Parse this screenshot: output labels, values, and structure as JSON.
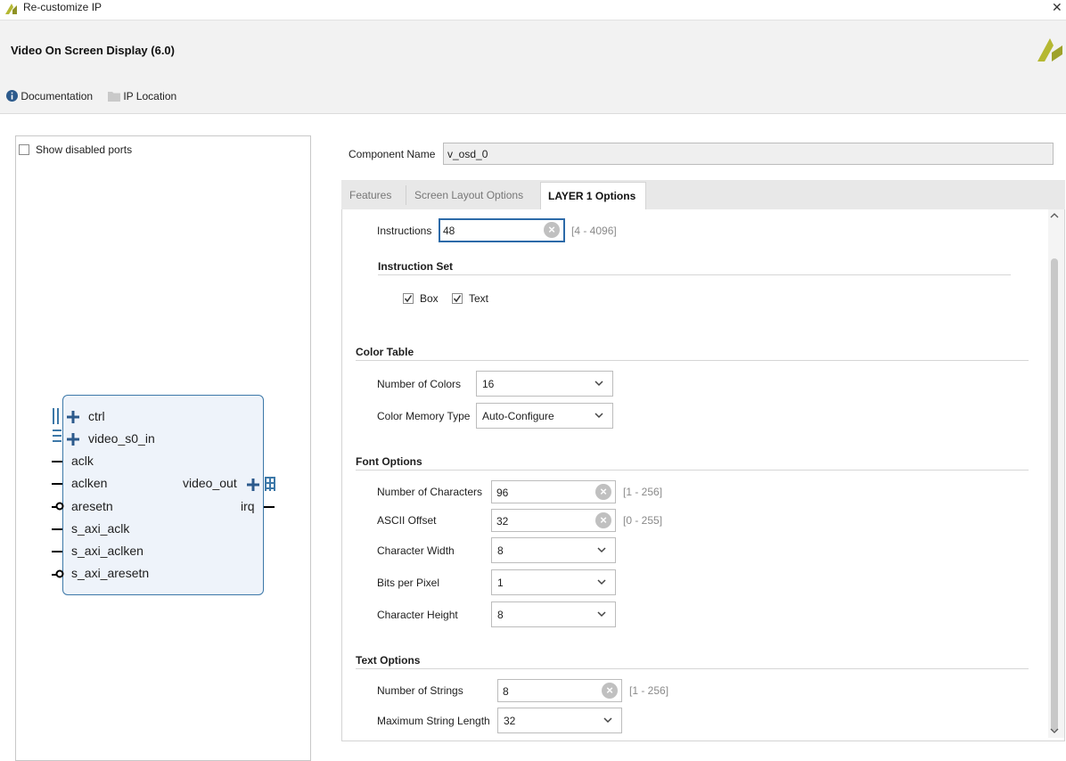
{
  "window": {
    "title": "Re-customize IP"
  },
  "header": {
    "title": "Video On Screen Display (6.0)",
    "links": {
      "documentation": "Documentation",
      "ip_location": "IP Location"
    }
  },
  "left_panel": {
    "show_disabled_ports": "Show disabled ports",
    "block": {
      "left_ports": [
        "ctrl",
        "video_s0_in",
        "aclk",
        "aclken",
        "aresetn",
        "s_axi_aclk",
        "s_axi_aclken",
        "s_axi_aresetn"
      ],
      "right_ports": [
        "video_out",
        "irq"
      ]
    }
  },
  "component": {
    "label": "Component Name",
    "value": "v_osd_0"
  },
  "tabs": [
    "Features",
    "Screen Layout Options",
    "LAYER 1 Options"
  ],
  "layer1": {
    "instructions": {
      "label": "Instructions",
      "value": "48",
      "range": "[4 - 4096]"
    },
    "instruction_set": {
      "title": "Instruction Set",
      "box": "Box",
      "text": "Text"
    },
    "color_table": {
      "title": "Color Table",
      "num_colors": {
        "label": "Number of Colors",
        "value": "16"
      },
      "mem_type": {
        "label": "Color Memory Type",
        "value": "Auto-Configure"
      }
    },
    "font_options": {
      "title": "Font Options",
      "num_chars": {
        "label": "Number of Characters",
        "value": "96",
        "range": "[1 - 256]"
      },
      "ascii_offset": {
        "label": "ASCII Offset",
        "value": "32",
        "range": "[0 - 255]"
      },
      "char_width": {
        "label": "Character Width",
        "value": "8"
      },
      "bits_per_pixel": {
        "label": "Bits per Pixel",
        "value": "1"
      },
      "char_height": {
        "label": "Character Height",
        "value": "8"
      }
    },
    "text_options": {
      "title": "Text Options",
      "num_strings": {
        "label": "Number of Strings",
        "value": "8",
        "range": "[1 - 256]"
      },
      "max_string_length": {
        "label": "Maximum String Length",
        "value": "32"
      }
    }
  },
  "colors": {
    "accent": "#2c6aa8",
    "logo": "#b5b832"
  }
}
